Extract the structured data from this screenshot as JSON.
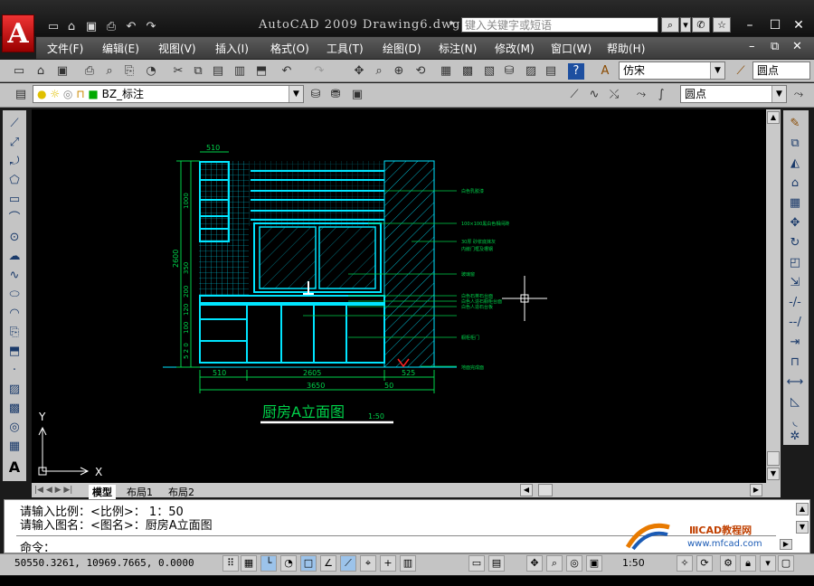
{
  "app": {
    "title": "AutoCAD 2009  Drawing6.dwg",
    "logo_letter": "A",
    "help_search_placeholder": "键入关键字或短语"
  },
  "menu": [
    "文件(F)",
    "编辑(E)",
    "视图(V)",
    "插入(I)",
    "格式(O)",
    "工具(T)",
    "绘图(D)",
    "标注(N)",
    "修改(M)",
    "窗口(W)",
    "帮助(H)"
  ],
  "toolbar": {
    "text_style": "仿宋",
    "point_style": "圆点",
    "layer": "BZ_标注",
    "linetype": "圆点"
  },
  "drawing": {
    "title": "厨房A立面图",
    "scale": "1:50",
    "dims_top": [
      "510"
    ],
    "dims_bottom": [
      "510",
      "2605",
      "525"
    ],
    "dim_total": "3650",
    "dim_small": "50",
    "dims_left": [
      "2600",
      "1000",
      "350",
      "200",
      "120",
      "100",
      "5 2 0"
    ],
    "notes": [
      "白色乳胶漆",
      "100×100黑白色相间砖",
      "30厚 砂浆底抹灰",
      "内嵌门框及槽钢",
      "玻璃窗",
      "白色石英石台面",
      "白色人造石橱柜台面",
      "白色人造石台板",
      "橱柜柜门",
      "地面完成面"
    ],
    "ucs_x": "X",
    "ucs_y": "Y"
  },
  "tabs": [
    "模型",
    "布局1",
    "布局2"
  ],
  "command": {
    "line1": "请输入比例：<比例>： 1：50",
    "line2": "请输入图名：<图名>：厨房A立面图",
    "prompt": "命令："
  },
  "status": {
    "coords": "50550.3261, 10969.7665, 0.0000",
    "annotation_scale": "1:50"
  },
  "watermark": {
    "site_name": "ⅢCAD教程网",
    "url": "www.mfcad.com"
  },
  "colors": {
    "cyan": "#00e5ff",
    "green": "#00d24a",
    "white": "#ffffff",
    "red": "#ff2020"
  }
}
